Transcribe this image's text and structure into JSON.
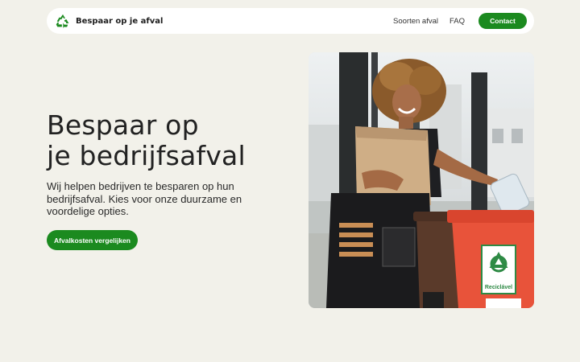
{
  "brand": {
    "name": "Bespaar op je afval",
    "icon": "recycle-icon",
    "color": "#1b8a1f"
  },
  "nav": {
    "links": [
      "Soorten afval",
      "FAQ"
    ],
    "contact_label": "Contact"
  },
  "hero": {
    "title_lines": [
      "Bespaar op",
      "je bedrijfsafval"
    ],
    "text_lines": [
      "Wij helpen bedrijven te besparen op hun",
      "bedrijfsafval. Kies voor onze duurzame en",
      "voordelige opties."
    ],
    "cta_label": "Afvalkosten vergelijken"
  },
  "photo": {
    "bin_label": "Reciclável"
  },
  "colors": {
    "background": "#f2f1ea",
    "accent": "#1b8a1f",
    "bin_orange": "#e8533a",
    "bin_brown": "#5a3a2a"
  }
}
